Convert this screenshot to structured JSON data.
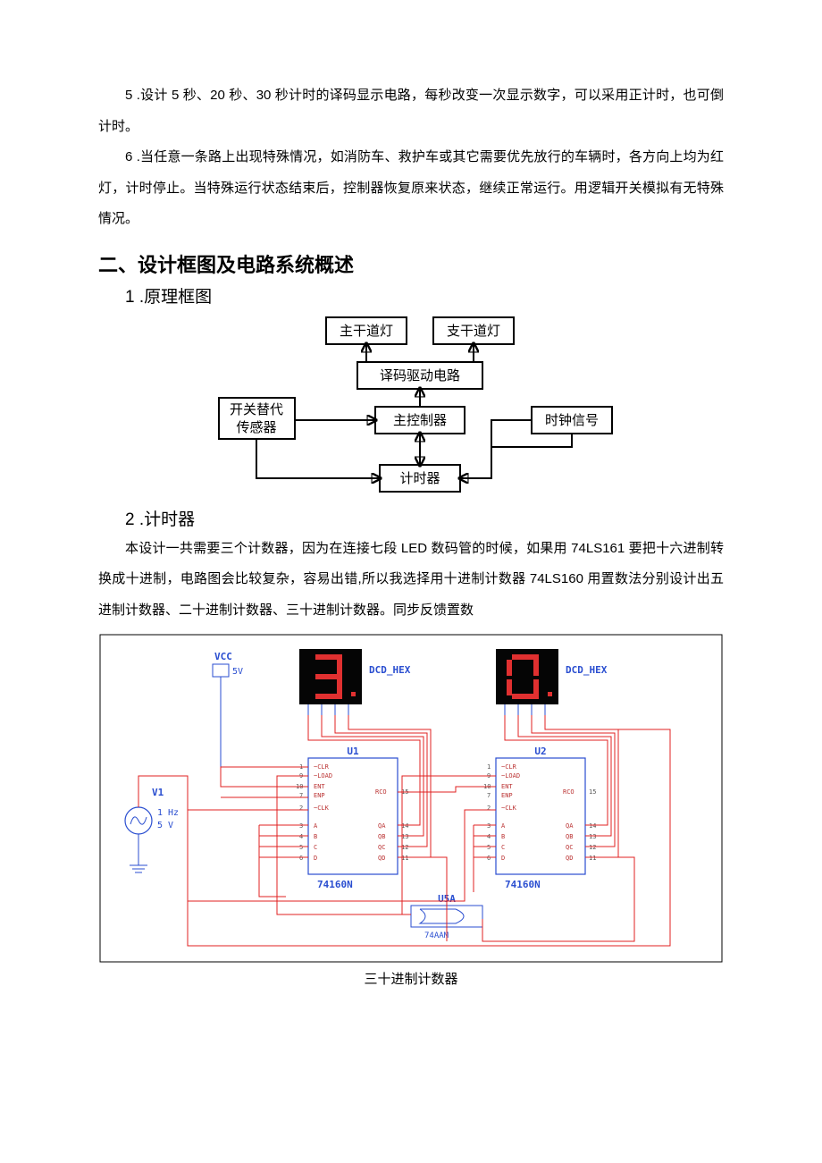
{
  "para5": "5  .设计 5 秒、20 秒、30 秒计时的译码显示电路，每秒改变一次显示数字，可以采用正计时，也可倒计时。",
  "para6": "6  .当任意一条路上出现特殊情况，如消防车、救护车或其它需要优先放行的车辆时，各方向上均为红灯，计时停止。当特殊运行状态结束后，控制器恢复原来状态，继续正常运行。用逻辑开关模拟有无特殊情况。",
  "h2": "二、设计框图及电路系统概述",
  "h3a": "1 .原理框图",
  "h3b": "2 .计时器",
  "blockdia": {
    "nodes": {
      "main_light": "主干道灯",
      "branch_light": "支干道灯",
      "decoder": "译码驱动电路",
      "sensor": "开关替代\n传感器",
      "controller": "主控制器",
      "clock": "时钟信号",
      "timer": "计时器"
    }
  },
  "timer_para": "本设计一共需要三个计数器，因为在连接七段 LED 数码管的时候，如果用 74LS161 要把十六进制转换成十进制，电路图会比较复杂，容易出错,所以我选择用十进制计数器 74LS160 用置数法分别设计出五进制计数器、二十进制计数器、三十进制计数器。同步反馈置数",
  "circuit": {
    "vcc": "VCC",
    "v5": "5V",
    "src": "V1",
    "hz": "1 Hz",
    "vsrc": "5 V",
    "dcd": "DCD_HEX",
    "u1": "U1",
    "u2": "U2",
    "u5a": "U5A",
    "part": "74160N",
    "gate": "74AAM",
    "seg_left": "3",
    "seg_right": "0",
    "pins": [
      "~CLR",
      "~LOAD",
      "ENT",
      "ENP",
      "RCO",
      "~CLK",
      "A",
      "B",
      "C",
      "D",
      "QA",
      "QB",
      "QC",
      "QD"
    ],
    "pnum_left": [
      "1",
      "9",
      "10",
      "7",
      "15",
      "2",
      "3",
      "4",
      "5",
      "6",
      "14",
      "13",
      "12",
      "11"
    ],
    "pnum_right": [
      "1",
      "9",
      "10",
      "7",
      "15",
      "2",
      "3",
      "4",
      "5",
      "6",
      "14",
      "13",
      "12",
      "11"
    ]
  },
  "caption": "三十进制计数器"
}
